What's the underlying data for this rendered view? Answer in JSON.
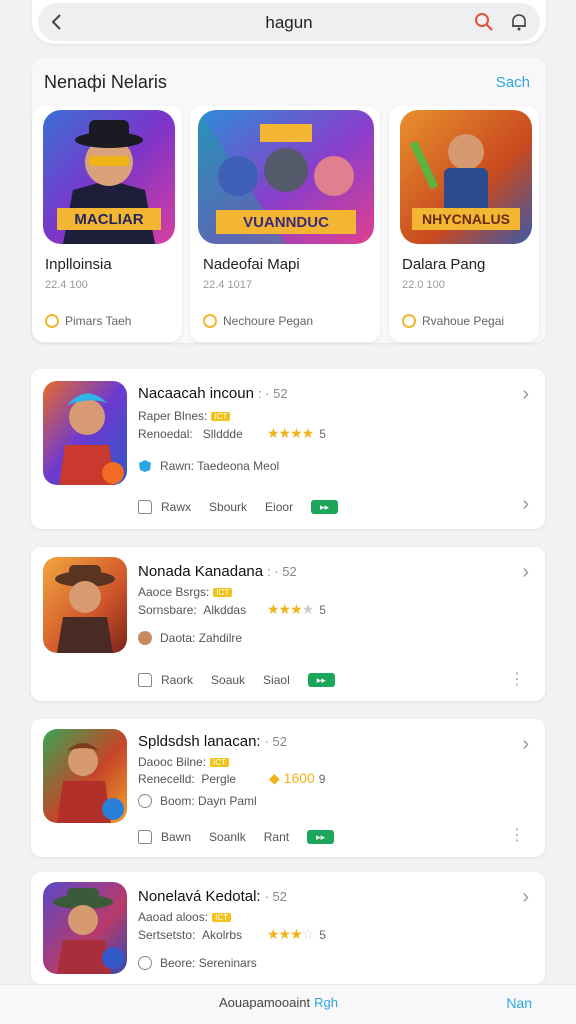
{
  "header": {
    "back_label": "‹",
    "title": "hagun",
    "search_icon": "search-icon",
    "notify_icon": "bell-icon",
    "accent": "#e0533a"
  },
  "featured": {
    "title": "Nenaфi Nelaris",
    "see_all": "Sach",
    "cards": [
      {
        "art_caption": "MACLIAR",
        "name": "Inplloinsia",
        "sub": "22.4 100",
        "tag": "Pimars Taeh"
      },
      {
        "art_caption": "VUANNDUC",
        "name": "Nadeofai Mapi",
        "sub": "22.4 1017",
        "tag": "Nechoure Pegan"
      },
      {
        "art_caption": "NHYCNALUS",
        "name": "Dalara Pang",
        "sub": "22.0 100",
        "tag": "Rvahoue Pegai"
      }
    ]
  },
  "list": [
    {
      "title": "Nacaacah incoun",
      "num": "52",
      "line1": "Raper Blnes:",
      "badge": "ICT",
      "line2_label": "Renoedal:",
      "line2_value": "Sllddde",
      "stars": "★★★★",
      "stars_empty": "",
      "score": "5",
      "line3": "Rawn:  Taedeona  Meol",
      "act1": "Rawx",
      "act2": "Sbourk",
      "act3": "Eioor"
    },
    {
      "title": "Nonada Kanadana",
      "num": "52",
      "line1": "Aaoce Bsrgs:",
      "badge": "ICT",
      "line2_label": "Sornsbare:",
      "line2_value": "Alkddas",
      "stars": "★★★",
      "stars_empty": "★",
      "score": "5",
      "line3": "Daota:  Zahdilre",
      "act1": "Raork",
      "act2": "Soauk",
      "act3": "Siaol"
    },
    {
      "title": "Spldsdsh lanacan:",
      "num": "52",
      "line1": "Daooc Bilne:",
      "badge": "ICT",
      "line2_label": "Renecelld:",
      "line2_value": "Pergle",
      "coins": "1600",
      "coins_suffix": "9",
      "line3": "Boom:  Dayn Paml",
      "act1": "Bawn",
      "act2": "Soanlk",
      "act3": "Rant"
    },
    {
      "title": "Nonelavá Kedotal:",
      "num": "52",
      "line1": "Aaoad aloos:",
      "badge": "ICT",
      "line2_label": "Sertsetsto:",
      "line2_value": "Akolrbs",
      "stars": "★★★",
      "stars_empty": "☆",
      "score": "5",
      "line3": "Beore:  Sereninars"
    }
  ],
  "bottom": {
    "text": "Aouapamooaint",
    "link": "Rgh",
    "right": "Nan"
  }
}
